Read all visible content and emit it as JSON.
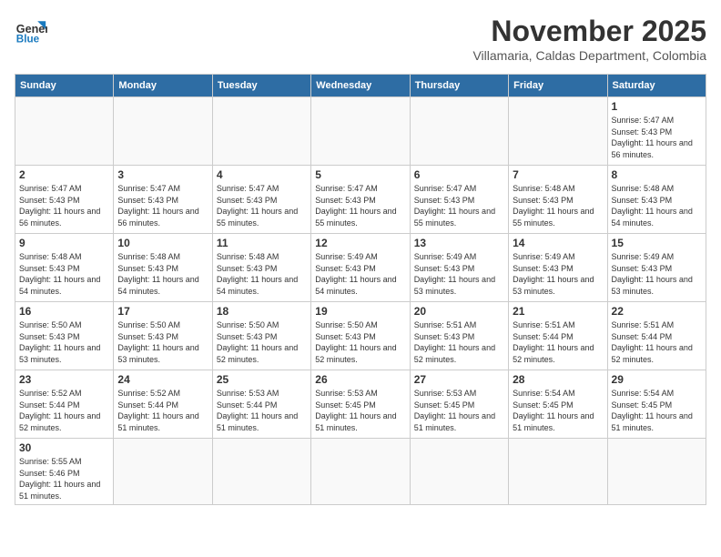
{
  "header": {
    "logo_line1": "General",
    "logo_line2": "Blue",
    "month": "November 2025",
    "location": "Villamaria, Caldas Department, Colombia"
  },
  "weekdays": [
    "Sunday",
    "Monday",
    "Tuesday",
    "Wednesday",
    "Thursday",
    "Friday",
    "Saturday"
  ],
  "weeks": [
    [
      {
        "day": "",
        "info": ""
      },
      {
        "day": "",
        "info": ""
      },
      {
        "day": "",
        "info": ""
      },
      {
        "day": "",
        "info": ""
      },
      {
        "day": "",
        "info": ""
      },
      {
        "day": "",
        "info": ""
      },
      {
        "day": "1",
        "info": "Sunrise: 5:47 AM\nSunset: 5:43 PM\nDaylight: 11 hours\nand 56 minutes."
      }
    ],
    [
      {
        "day": "2",
        "info": "Sunrise: 5:47 AM\nSunset: 5:43 PM\nDaylight: 11 hours\nand 56 minutes."
      },
      {
        "day": "3",
        "info": "Sunrise: 5:47 AM\nSunset: 5:43 PM\nDaylight: 11 hours\nand 56 minutes."
      },
      {
        "day": "4",
        "info": "Sunrise: 5:47 AM\nSunset: 5:43 PM\nDaylight: 11 hours\nand 55 minutes."
      },
      {
        "day": "5",
        "info": "Sunrise: 5:47 AM\nSunset: 5:43 PM\nDaylight: 11 hours\nand 55 minutes."
      },
      {
        "day": "6",
        "info": "Sunrise: 5:47 AM\nSunset: 5:43 PM\nDaylight: 11 hours\nand 55 minutes."
      },
      {
        "day": "7",
        "info": "Sunrise: 5:48 AM\nSunset: 5:43 PM\nDaylight: 11 hours\nand 55 minutes."
      },
      {
        "day": "8",
        "info": "Sunrise: 5:48 AM\nSunset: 5:43 PM\nDaylight: 11 hours\nand 54 minutes."
      }
    ],
    [
      {
        "day": "9",
        "info": "Sunrise: 5:48 AM\nSunset: 5:43 PM\nDaylight: 11 hours\nand 54 minutes."
      },
      {
        "day": "10",
        "info": "Sunrise: 5:48 AM\nSunset: 5:43 PM\nDaylight: 11 hours\nand 54 minutes."
      },
      {
        "day": "11",
        "info": "Sunrise: 5:48 AM\nSunset: 5:43 PM\nDaylight: 11 hours\nand 54 minutes."
      },
      {
        "day": "12",
        "info": "Sunrise: 5:49 AM\nSunset: 5:43 PM\nDaylight: 11 hours\nand 54 minutes."
      },
      {
        "day": "13",
        "info": "Sunrise: 5:49 AM\nSunset: 5:43 PM\nDaylight: 11 hours\nand 53 minutes."
      },
      {
        "day": "14",
        "info": "Sunrise: 5:49 AM\nSunset: 5:43 PM\nDaylight: 11 hours\nand 53 minutes."
      },
      {
        "day": "15",
        "info": "Sunrise: 5:49 AM\nSunset: 5:43 PM\nDaylight: 11 hours\nand 53 minutes."
      }
    ],
    [
      {
        "day": "16",
        "info": "Sunrise: 5:50 AM\nSunset: 5:43 PM\nDaylight: 11 hours\nand 53 minutes."
      },
      {
        "day": "17",
        "info": "Sunrise: 5:50 AM\nSunset: 5:43 PM\nDaylight: 11 hours\nand 53 minutes."
      },
      {
        "day": "18",
        "info": "Sunrise: 5:50 AM\nSunset: 5:43 PM\nDaylight: 11 hours\nand 52 minutes."
      },
      {
        "day": "19",
        "info": "Sunrise: 5:50 AM\nSunset: 5:43 PM\nDaylight: 11 hours\nand 52 minutes."
      },
      {
        "day": "20",
        "info": "Sunrise: 5:51 AM\nSunset: 5:43 PM\nDaylight: 11 hours\nand 52 minutes."
      },
      {
        "day": "21",
        "info": "Sunrise: 5:51 AM\nSunset: 5:44 PM\nDaylight: 11 hours\nand 52 minutes."
      },
      {
        "day": "22",
        "info": "Sunrise: 5:51 AM\nSunset: 5:44 PM\nDaylight: 11 hours\nand 52 minutes."
      }
    ],
    [
      {
        "day": "23",
        "info": "Sunrise: 5:52 AM\nSunset: 5:44 PM\nDaylight: 11 hours\nand 52 minutes."
      },
      {
        "day": "24",
        "info": "Sunrise: 5:52 AM\nSunset: 5:44 PM\nDaylight: 11 hours\nand 51 minutes."
      },
      {
        "day": "25",
        "info": "Sunrise: 5:53 AM\nSunset: 5:44 PM\nDaylight: 11 hours\nand 51 minutes."
      },
      {
        "day": "26",
        "info": "Sunrise: 5:53 AM\nSunset: 5:45 PM\nDaylight: 11 hours\nand 51 minutes."
      },
      {
        "day": "27",
        "info": "Sunrise: 5:53 AM\nSunset: 5:45 PM\nDaylight: 11 hours\nand 51 minutes."
      },
      {
        "day": "28",
        "info": "Sunrise: 5:54 AM\nSunset: 5:45 PM\nDaylight: 11 hours\nand 51 minutes."
      },
      {
        "day": "29",
        "info": "Sunrise: 5:54 AM\nSunset: 5:45 PM\nDaylight: 11 hours\nand 51 minutes."
      }
    ],
    [
      {
        "day": "30",
        "info": "Sunrise: 5:55 AM\nSunset: 5:46 PM\nDaylight: 11 hours\nand 51 minutes."
      },
      {
        "day": "",
        "info": ""
      },
      {
        "day": "",
        "info": ""
      },
      {
        "day": "",
        "info": ""
      },
      {
        "day": "",
        "info": ""
      },
      {
        "day": "",
        "info": ""
      },
      {
        "day": "",
        "info": ""
      }
    ]
  ]
}
